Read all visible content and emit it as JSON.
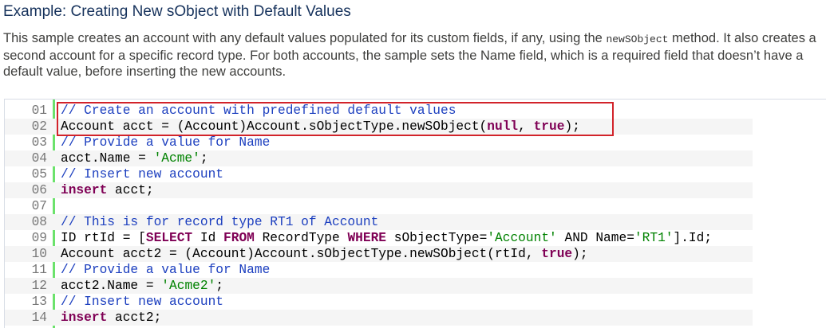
{
  "heading": "Example: Creating New sObject with Default Values",
  "description": {
    "part1": "This sample creates an account with any default values populated for its custom fields, if any, using the ",
    "method_code": "newSObject",
    "part2": " method. It also creates a second account for a specific record type. For both accounts, the sample sets the Name field, which is a required field that doesn’t have a default value, before inserting the new accounts."
  },
  "code": {
    "line_numbers": [
      "01",
      "02",
      "03",
      "04",
      "05",
      "06",
      "07",
      "08",
      "09",
      "10",
      "11",
      "12",
      "13",
      "14"
    ],
    "lines": [
      [
        {
          "t": "cm",
          "v": "// Create an account with predefined default values"
        }
      ],
      [
        {
          "t": "tx",
          "v": "Account acct = (Account)Account.sObjectType.newSObject("
        },
        {
          "t": "kw",
          "v": "null"
        },
        {
          "t": "tx",
          "v": ", "
        },
        {
          "t": "kw",
          "v": "true"
        },
        {
          "t": "tx",
          "v": ");"
        }
      ],
      [
        {
          "t": "cm",
          "v": "// Provide a value for Name"
        }
      ],
      [
        {
          "t": "tx",
          "v": "acct.Name = "
        },
        {
          "t": "str",
          "v": "'Acme'"
        },
        {
          "t": "tx",
          "v": ";"
        }
      ],
      [
        {
          "t": "cm",
          "v": "// Insert new account"
        }
      ],
      [
        {
          "t": "kw",
          "v": "insert"
        },
        {
          "t": "tx",
          "v": " acct;"
        }
      ],
      [],
      [
        {
          "t": "cm",
          "v": "// This is for record type RT1 of Account"
        }
      ],
      [
        {
          "t": "tx",
          "v": "ID rtId = ["
        },
        {
          "t": "kw",
          "v": "SELECT"
        },
        {
          "t": "tx",
          "v": " Id "
        },
        {
          "t": "kw",
          "v": "FROM"
        },
        {
          "t": "tx",
          "v": " RecordType "
        },
        {
          "t": "kw",
          "v": "WHERE"
        },
        {
          "t": "tx",
          "v": " sObjectType="
        },
        {
          "t": "str",
          "v": "'Account'"
        },
        {
          "t": "tx",
          "v": " AND Name="
        },
        {
          "t": "str",
          "v": "'RT1'"
        },
        {
          "t": "tx",
          "v": "].Id;"
        }
      ],
      [
        {
          "t": "tx",
          "v": "Account acct2 = (Account)Account.sObjectType.newSObject(rtId, "
        },
        {
          "t": "kw",
          "v": "true"
        },
        {
          "t": "tx",
          "v": ");"
        }
      ],
      [
        {
          "t": "cm",
          "v": "// Provide a value for Name"
        }
      ],
      [
        {
          "t": "tx",
          "v": "acct2.Name = "
        },
        {
          "t": "str",
          "v": "'Acme2'"
        },
        {
          "t": "tx",
          "v": ";"
        }
      ],
      [
        {
          "t": "cm",
          "v": "// Insert new account"
        }
      ],
      [
        {
          "t": "kw",
          "v": "insert"
        },
        {
          "t": "tx",
          "v": " acct2;"
        }
      ]
    ]
  },
  "colors": {
    "heading": "#16325c",
    "comment": "#1c3fbf",
    "keyword": "#7f0055",
    "string": "#008200",
    "highlight_border": "#d2232a",
    "gutter_bar": "#6ce26c"
  }
}
